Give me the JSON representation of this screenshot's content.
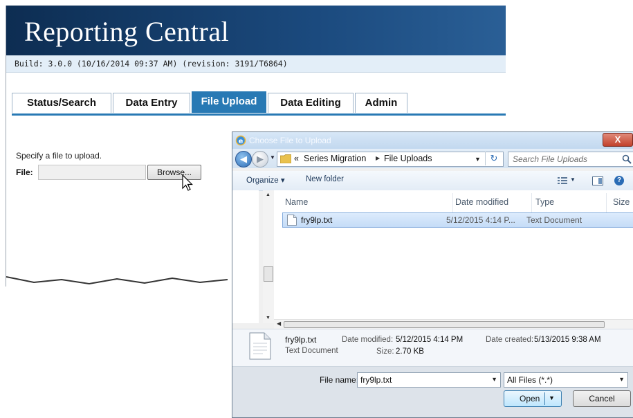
{
  "app": {
    "title": "Reporting Central",
    "build": "Build: 3.0.0 (10/16/2014 09:37 AM) (revision: 3191/T6864)",
    "tabs": [
      {
        "label": "Status/Search",
        "active": false
      },
      {
        "label": "Data Entry",
        "active": false
      },
      {
        "label": "File Upload",
        "active": true
      },
      {
        "label": "Data Editing",
        "active": false
      },
      {
        "label": "Admin",
        "active": false
      }
    ],
    "upload": {
      "hint": "Specify a file to upload.",
      "file_label": "File:",
      "file_value": "",
      "browse_label": "Browse..."
    }
  },
  "dialog": {
    "title": "Choose File to Upload",
    "close_label": "X",
    "breadcrumb": {
      "prefix": "«",
      "items": [
        "Series Migration",
        "File Uploads"
      ]
    },
    "search_placeholder": "Search File Uploads",
    "toolbar": {
      "organize": "Organize ▾",
      "new_folder": "New folder"
    },
    "columns": [
      "Name",
      "Date modified",
      "Type",
      "Size"
    ],
    "files": [
      {
        "name": "fry9lp.txt",
        "date": "5/12/2015 4:14 P...",
        "type": "Text Document",
        "size": ""
      }
    ],
    "details": {
      "name": "fry9lp.txt",
      "type": "Text Document",
      "date_modified_label": "Date modified:",
      "date_modified": "5/12/2015 4:14 PM",
      "date_created_label": "Date created:",
      "date_created": "5/13/2015 9:38 AM",
      "size_label": "Size:",
      "size": "2.70 KB"
    },
    "filename_label": "File name:",
    "filename_value": "fry9lp.txt",
    "filetype_value": "All Files (*.*)",
    "open_label": "Open",
    "cancel_label": "Cancel"
  },
  "colors": {
    "banner": "#0d2d52",
    "tab_active": "#2879b4",
    "selected_row": "#cfe3fb",
    "dialog_frame": "#c2d8ef"
  },
  "icons": [
    "cursor-arrow-icon",
    "folder-icon",
    "search-icon",
    "doc-icon",
    "back-arrow-icon",
    "forward-arrow-icon",
    "refresh-icon",
    "help-icon",
    "view-icon",
    "preview-pane-icon",
    "close-icon"
  ]
}
